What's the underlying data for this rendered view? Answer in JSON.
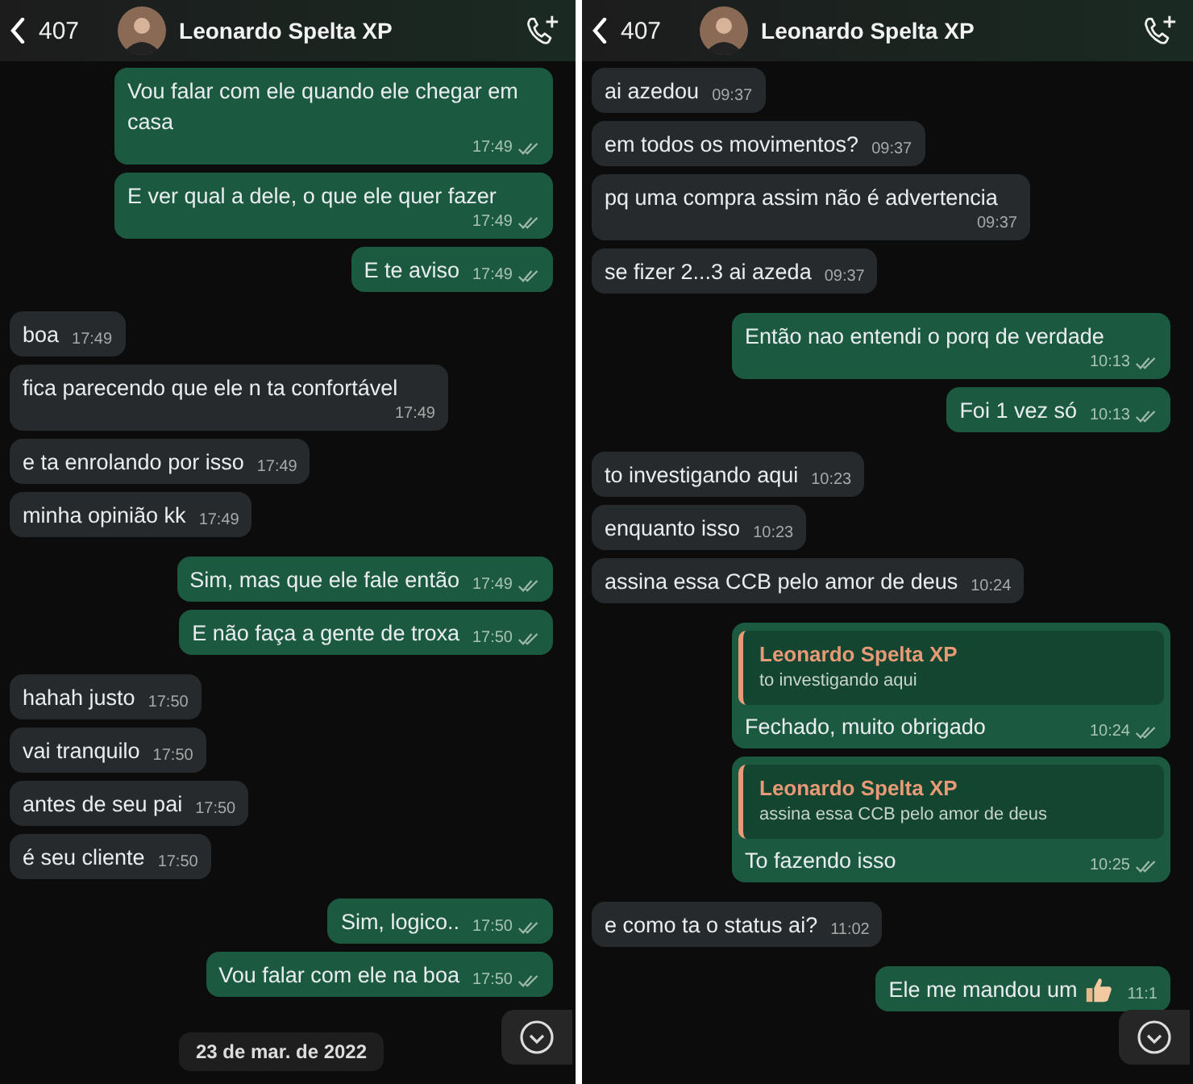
{
  "panels": [
    {
      "header": {
        "back_count": "407",
        "contact_name": "Leonardo Spelta XP"
      },
      "messages": [
        {
          "kind": "outgoing",
          "text": "Vou falar com ele quando ele chegar em casa",
          "time": "17:49",
          "read": true
        },
        {
          "kind": "outgoing",
          "text": "E ver qual a dele, o que ele quer fazer",
          "time": "17:49",
          "read": true
        },
        {
          "kind": "outgoing",
          "text": "E te aviso",
          "time": "17:49",
          "read": true
        },
        {
          "kind": "incoming",
          "text": "boa",
          "time": "17:49"
        },
        {
          "kind": "incoming",
          "text": "fica parecendo que ele n ta confortável",
          "time": "17:49"
        },
        {
          "kind": "incoming",
          "text": "e ta enrolando por isso",
          "time": "17:49"
        },
        {
          "kind": "incoming",
          "text": "minha opinião kk",
          "time": "17:49"
        },
        {
          "kind": "outgoing",
          "text": "Sim, mas que ele fale então",
          "time": "17:49",
          "read": true
        },
        {
          "kind": "outgoing",
          "text": "E não faça a gente de troxa",
          "time": "17:50",
          "read": true
        },
        {
          "kind": "incoming",
          "text": "hahah justo",
          "time": "17:50"
        },
        {
          "kind": "incoming",
          "text": "vai tranquilo",
          "time": "17:50"
        },
        {
          "kind": "incoming",
          "text": "antes de seu pai",
          "time": "17:50"
        },
        {
          "kind": "incoming",
          "text": "é seu cliente",
          "time": "17:50"
        },
        {
          "kind": "outgoing",
          "text": "Sim, logico..",
          "time": "17:50",
          "read": true
        },
        {
          "kind": "outgoing",
          "text": "Vou falar com ele na boa",
          "time": "17:50",
          "read": true
        },
        {
          "kind": "date",
          "text": "23 de mar. de 2022"
        }
      ]
    },
    {
      "header": {
        "back_count": "407",
        "contact_name": "Leonardo Spelta XP"
      },
      "messages": [
        {
          "kind": "incoming",
          "text": "ai azedou",
          "time": "09:37"
        },
        {
          "kind": "incoming",
          "text": "em todos os movimentos?",
          "time": "09:37"
        },
        {
          "kind": "incoming",
          "text": "pq uma compra assim não é advertencia",
          "time": "09:37"
        },
        {
          "kind": "incoming",
          "text": "se fizer 2...3 ai azeda",
          "time": "09:37"
        },
        {
          "kind": "outgoing",
          "text": "Então nao entendi o porq de verdade",
          "time": "10:13",
          "read": true
        },
        {
          "kind": "outgoing",
          "text": "Foi 1 vez só",
          "time": "10:13",
          "read": true
        },
        {
          "kind": "incoming",
          "text": "to investigando aqui",
          "time": "10:23"
        },
        {
          "kind": "incoming",
          "text": "enquanto isso",
          "time": "10:23"
        },
        {
          "kind": "incoming",
          "text": "assina essa CCB pelo amor de deus",
          "time": "10:24"
        },
        {
          "kind": "outgoing",
          "quote": {
            "author": "Leonardo Spelta XP",
            "text": "to investigando aqui"
          },
          "text": "Fechado, muito obrigado",
          "time": "10:24",
          "read": true
        },
        {
          "kind": "outgoing",
          "quote": {
            "author": "Leonardo Spelta XP",
            "text": "assina essa CCB pelo amor de deus"
          },
          "text": "To fazendo isso",
          "time": "10:25",
          "read": true
        },
        {
          "kind": "incoming",
          "text": "e como ta o status ai?",
          "time": "11:02"
        },
        {
          "kind": "outgoing",
          "text": "Ele me mandou um",
          "trailing_thumb": true,
          "time": "11:1"
        }
      ]
    }
  ]
}
